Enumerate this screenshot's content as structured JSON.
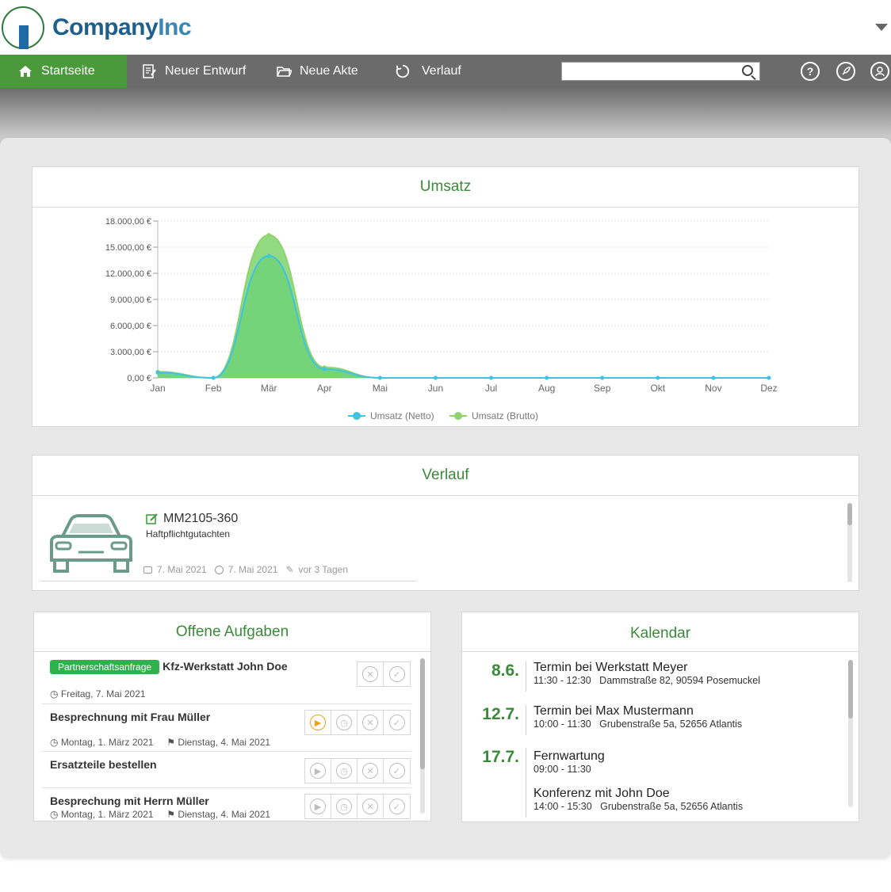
{
  "brand": {
    "name_part1": "Company",
    "name_part2": "Inc"
  },
  "nav": {
    "items": [
      {
        "label": "Startseite",
        "icon": "home-icon"
      },
      {
        "label": "Neuer Entwurf",
        "icon": "draft-icon"
      },
      {
        "label": "Neue Akte",
        "icon": "folder-icon"
      },
      {
        "label": "Verlauf",
        "icon": "history-icon"
      }
    ],
    "search_placeholder": "",
    "accent": "#4a9a3c"
  },
  "umsatz": {
    "title": "Umsatz",
    "chart_data": {
      "type": "area",
      "categories": [
        "Jan",
        "Feb",
        "Mär",
        "Apr",
        "Mai",
        "Jun",
        "Jul",
        "Aug",
        "Sep",
        "Okt",
        "Nov",
        "Dez"
      ],
      "y_ticks": [
        "0,00 €",
        "3.000,00 €",
        "6.000,00 €",
        "9.000,00 €",
        "12.000,00 €",
        "15.000,00 €",
        "18.000,00 €"
      ],
      "ylim": [
        0,
        18000
      ],
      "series": [
        {
          "name": "Umsatz (Netto)",
          "color": "#3ec3e0",
          "values": [
            600,
            0,
            14000,
            1000,
            0,
            0,
            0,
            0,
            0,
            0,
            0,
            0
          ]
        },
        {
          "name": "Umsatz (Brutto)",
          "color": "#8ed36b",
          "values": [
            700,
            0,
            16400,
            1200,
            0,
            0,
            0,
            0,
            0,
            0,
            0,
            0
          ]
        }
      ],
      "legend": "bottom",
      "grid": true
    }
  },
  "verlauf": {
    "title": "Verlauf",
    "item": {
      "id": "MM2105-360",
      "type": "Haftpflichtgutachten",
      "created": "7. Mai 2021",
      "modified": "7. Mai 2021",
      "edited": "vor 3 Tagen"
    }
  },
  "aufgaben": {
    "title": "Offene Aufgaben",
    "tasks": [
      {
        "badge": "Partnerschaftsanfrage",
        "title": "Kfz-Werkstatt John Doe",
        "date": "Freitag, 7. Mai 2021",
        "due": ""
      },
      {
        "badge": "",
        "title": "Besprechnung mit Frau Müller",
        "date": "Montag, 1. März 2021",
        "due": "Dienstag, 4. Mai 2021"
      },
      {
        "badge": "",
        "title": "Ersatzteile bestellen",
        "date": "",
        "due": ""
      },
      {
        "badge": "",
        "title": "Besprechung mit Herrn Müller",
        "date": "Montag, 1. März 2021",
        "due": "Dienstag, 4. Mai 2021"
      }
    ]
  },
  "kalendar": {
    "title": "Kalendar",
    "entries": [
      {
        "date": "8.6.",
        "title": "Termin bei Werkstatt Meyer",
        "time": "11:30 - 12:30",
        "place": "Dammstraße 82, 90594 Posemuckel"
      },
      {
        "date": "12.7.",
        "title": "Termin bei Max Mustermann",
        "time": "10:00 - 11:30",
        "place": "Grubenstraße 5a, 52656 Atlantis"
      },
      {
        "date": "17.7.",
        "title": "Fernwartung",
        "time": "09:00 - 11:30",
        "place": ""
      },
      {
        "date": "",
        "title": "Konferenz mit John Doe",
        "time": "14:00 - 15:30",
        "place": "Grubenstraße 5a, 52656 Atlantis"
      }
    ]
  }
}
